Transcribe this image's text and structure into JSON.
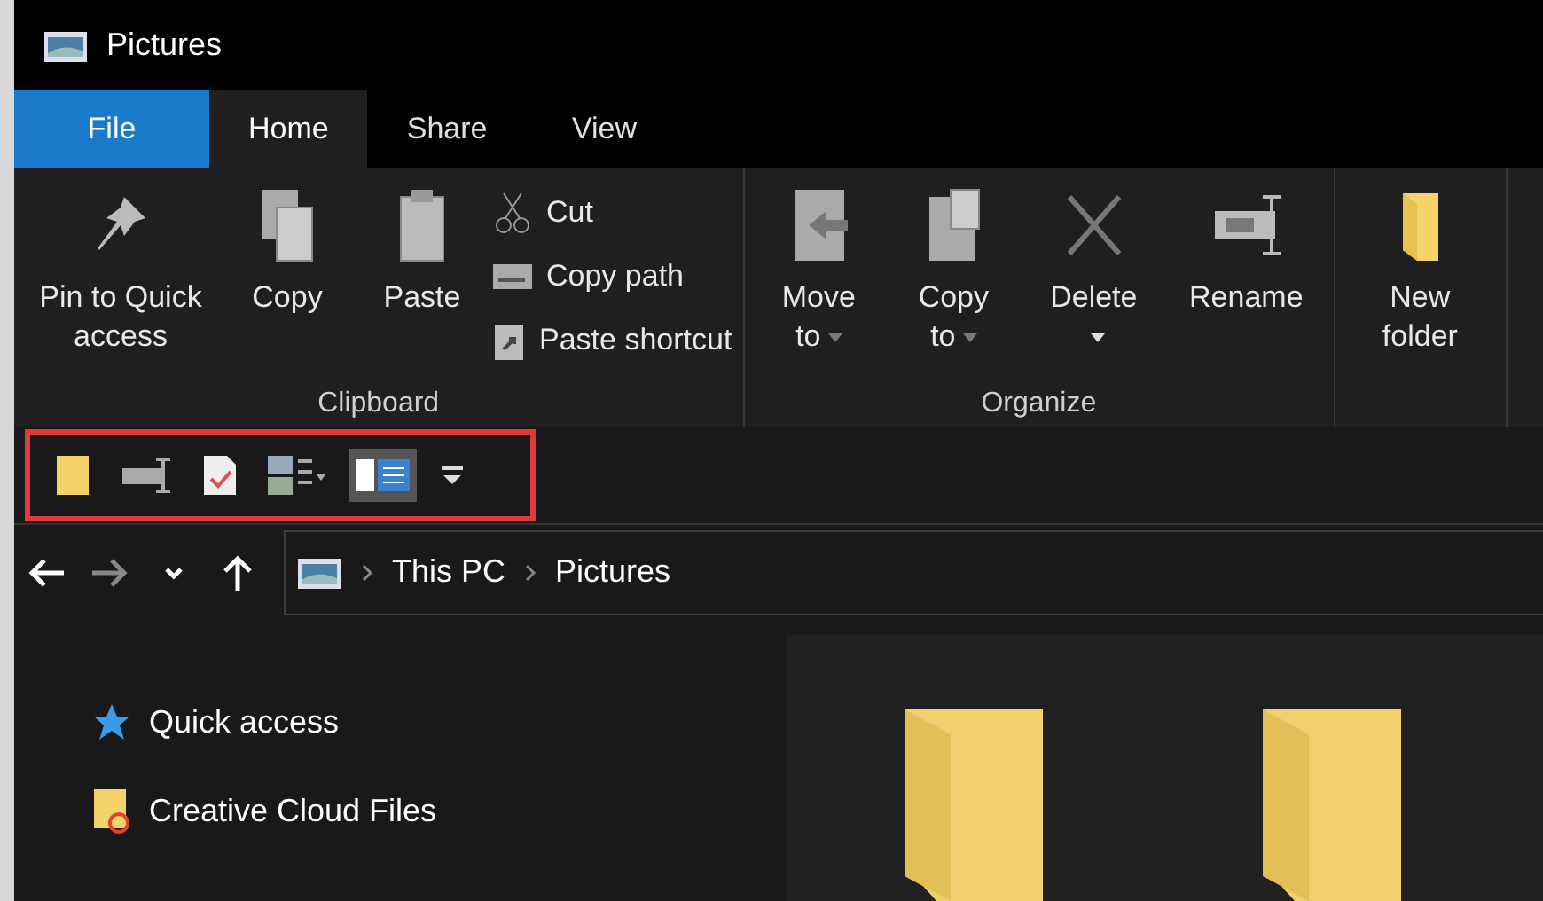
{
  "window": {
    "title": "Pictures"
  },
  "tabs": [
    {
      "label": "File",
      "kind": "file",
      "selected": false
    },
    {
      "label": "Home",
      "kind": "tab",
      "selected": true
    },
    {
      "label": "Share",
      "kind": "tab",
      "selected": false
    },
    {
      "label": "View",
      "kind": "tab",
      "selected": false
    }
  ],
  "ribbon": {
    "groups": [
      {
        "label": "Clipboard",
        "commands": [
          {
            "label": "Pin to Quick access",
            "kind": "large",
            "dropdown": false
          },
          {
            "label": "Copy",
            "kind": "large",
            "dropdown": false
          },
          {
            "label": "Paste",
            "kind": "large",
            "dropdown": false
          },
          {
            "label": "Cut",
            "kind": "small"
          },
          {
            "label": "Copy path",
            "kind": "small"
          },
          {
            "label": "Paste shortcut",
            "kind": "small"
          }
        ]
      },
      {
        "label": "Organize",
        "commands": [
          {
            "label": "Move to",
            "kind": "large",
            "dropdown": true
          },
          {
            "label": "Copy to",
            "kind": "large",
            "dropdown": true
          },
          {
            "label": "Delete",
            "kind": "large",
            "dropdown": true
          },
          {
            "label": "Rename",
            "kind": "large",
            "dropdown": false
          }
        ]
      },
      {
        "commands": [
          {
            "label": "New folder",
            "kind": "large",
            "dropdown": false
          }
        ]
      }
    ]
  },
  "quick_access_toolbar": {
    "highlighted": true,
    "buttons": [
      {
        "pressed": false
      },
      {
        "pressed": false
      },
      {
        "pressed": false
      },
      {
        "pressed": false
      },
      {
        "pressed": true
      },
      {
        "pressed": false
      }
    ]
  },
  "navigation": [
    {
      "disabled": false
    },
    {
      "disabled": true
    },
    {
      "disabled": false
    },
    {
      "disabled": false
    }
  ],
  "address_bar": {
    "segments": [
      "This PC",
      "Pictures"
    ]
  },
  "sidebar": {
    "items": [
      {
        "label": "Quick access"
      },
      {
        "label": "Creative Cloud Files"
      }
    ]
  }
}
